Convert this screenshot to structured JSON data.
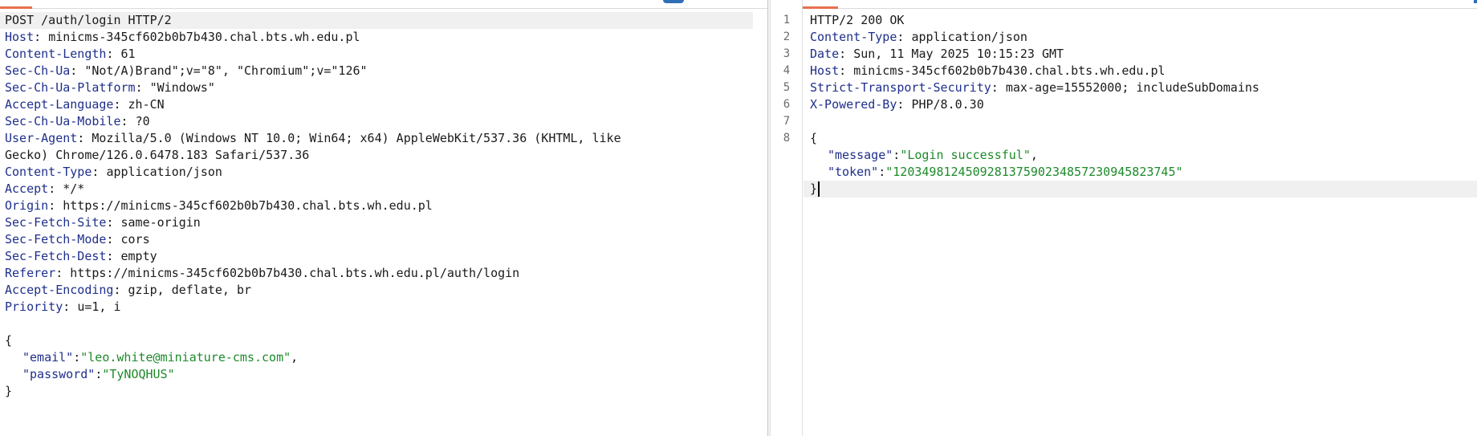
{
  "request": {
    "request_line": "POST /auth/login HTTP/2",
    "headers": [
      {
        "name": "Host",
        "value": "minicms-345cf602b0b7b430.chal.bts.wh.edu.pl"
      },
      {
        "name": "Content-Length",
        "value": "61"
      },
      {
        "name": "Sec-Ch-Ua",
        "value": "\"Not/A)Brand\";v=\"8\", \"Chromium\";v=\"126\""
      },
      {
        "name": "Sec-Ch-Ua-Platform",
        "value": "\"Windows\""
      },
      {
        "name": "Accept-Language",
        "value": "zh-CN"
      },
      {
        "name": "Sec-Ch-Ua-Mobile",
        "value": "?0"
      },
      {
        "name": "User-Agent",
        "value": "Mozilla/5.0 (Windows NT 10.0; Win64; x64) AppleWebKit/537.36 (KHTML, like"
      },
      {
        "name": "",
        "value": "Gecko) Chrome/126.0.6478.183 Safari/537.36"
      },
      {
        "name": "Content-Type",
        "value": "application/json"
      },
      {
        "name": "Accept",
        "value": "*/*"
      },
      {
        "name": "Origin",
        "value": "https://minicms-345cf602b0b7b430.chal.bts.wh.edu.pl"
      },
      {
        "name": "Sec-Fetch-Site",
        "value": "same-origin"
      },
      {
        "name": "Sec-Fetch-Mode",
        "value": "cors"
      },
      {
        "name": "Sec-Fetch-Dest",
        "value": "empty"
      },
      {
        "name": "Referer",
        "value": "https://minicms-345cf602b0b7b430.chal.bts.wh.edu.pl/auth/login"
      },
      {
        "name": "Accept-Encoding",
        "value": "gzip, deflate, br"
      },
      {
        "name": "Priority",
        "value": "u=1, i"
      }
    ],
    "body": {
      "open": "{",
      "fields": [
        {
          "key": "\"email\"",
          "value": "\"leo.white@miniature-cms.com\"",
          "trail": ","
        },
        {
          "key": "\"password\"",
          "value": "\"TyNOQHUS\"",
          "trail": ""
        }
      ],
      "close": "}"
    }
  },
  "response": {
    "line_numbers": [
      "1",
      "2",
      "3",
      "4",
      "5",
      "6",
      "7",
      "8"
    ],
    "status_line": "HTTP/2 200 OK",
    "headers": [
      {
        "name": "Content-Type",
        "value": "application/json"
      },
      {
        "name": "Date",
        "value": "Sun, 11 May 2025 10:15:23 GMT"
      },
      {
        "name": "Host",
        "value": "minicms-345cf602b0b7b430.chal.bts.wh.edu.pl"
      },
      {
        "name": "Strict-Transport-Security",
        "value": "max-age=15552000; includeSubDomains"
      },
      {
        "name": "X-Powered-By",
        "value": "PHP/8.0.30"
      }
    ],
    "body": {
      "open": "{",
      "fields": [
        {
          "key": "\"message\"",
          "value": "\"Login successful\"",
          "trail": ","
        },
        {
          "key": "\"token\"",
          "value": "\"120349812450928137590234857230945823745\"",
          "trail": ""
        }
      ],
      "close": "}"
    }
  },
  "colors": {
    "header_name": "#1f2f8c",
    "json_string": "#1d8a2a",
    "tab_accent": "#e8704f",
    "button_accent": "#2f6fb7"
  }
}
